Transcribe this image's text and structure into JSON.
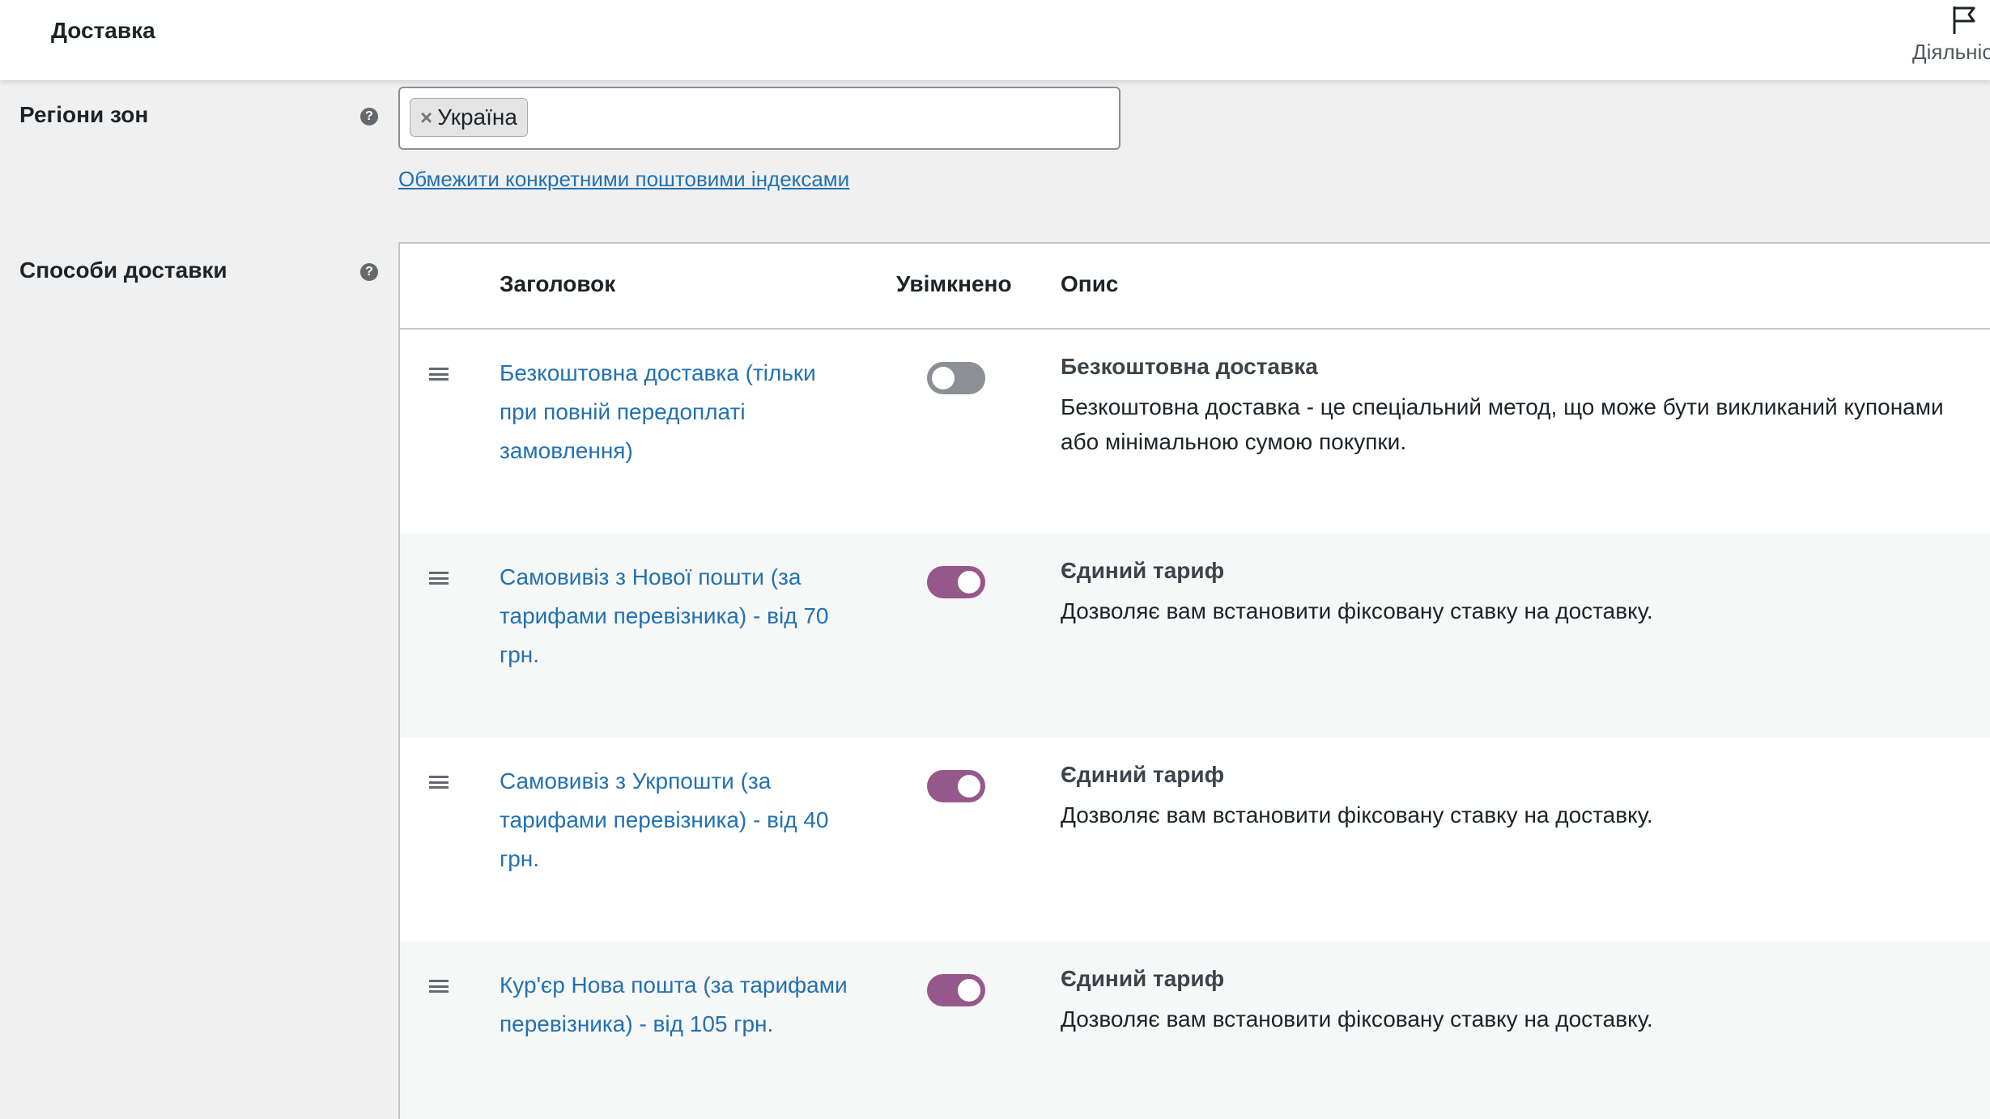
{
  "header": {
    "title": "Доставка",
    "activity_label": "Діяльніс"
  },
  "zone_regions": {
    "label": "Регіони зон",
    "selected": [
      {
        "name": "Україна",
        "remove_symbol": "×"
      }
    ],
    "limit_link": "Обмежити конкретними поштовими індексами"
  },
  "shipping_methods": {
    "label": "Способи доставки",
    "columns": {
      "title": "Заголовок",
      "enabled": "Увімкнено",
      "description": "Опис"
    },
    "rows": [
      {
        "title": "Безкоштовна доставка (тільки при повній передоплаті замовлення)",
        "enabled": false,
        "method_name": "Безкоштовна доставка",
        "method_description": "Безкоштовна доставка - це спеціальний метод, що може бути викликаний купонами або мінімальною сумою покупки."
      },
      {
        "title": "Самовивіз з Нової пошти (за тарифами перевізника) - від 70 грн.",
        "enabled": true,
        "method_name": "Єдиний тариф",
        "method_description": "Дозволяє вам встановити фіксовану ставку на доставку."
      },
      {
        "title": "Самовивіз з Укрпошти (за тарифами перевізника) - від 40 грн.",
        "enabled": true,
        "method_name": "Єдиний тариф",
        "method_description": "Дозволяє вам встановити фіксовану ставку на доставку."
      },
      {
        "title": "Кур'єр Нова пошта (за тарифами перевізника) - від 105 грн.",
        "enabled": true,
        "method_name": "Єдиний тариф",
        "method_description": "Дозволяє вам встановити фіксовану ставку на доставку."
      }
    ]
  },
  "colors": {
    "accent_toggle_on": "#96588a",
    "toggle_off": "#8c8f94",
    "link": "#2271b1"
  }
}
